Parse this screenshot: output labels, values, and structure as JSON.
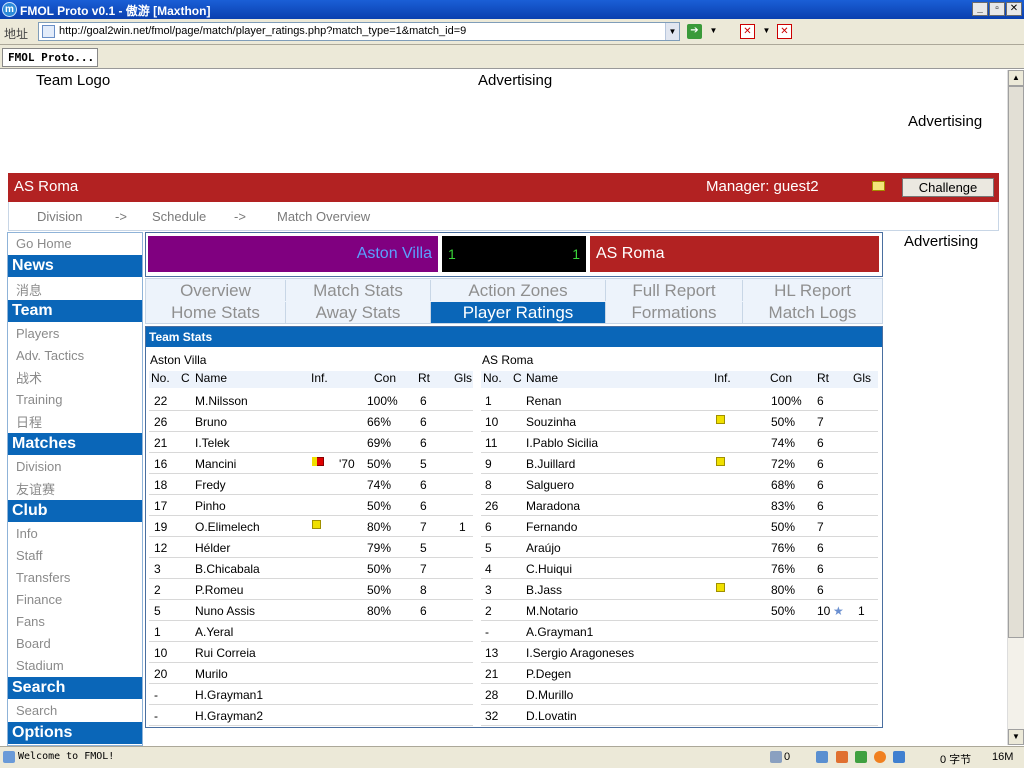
{
  "window": {
    "title": "FMOL Proto v0.1 - 傲游 [Maxthon]"
  },
  "addressbar": {
    "label": "地址",
    "url": "http://goal2win.net/fmol/page/match/player_ratings.php?match_type=1&match_id=9"
  },
  "browser_tab": {
    "label": "FMOL Proto..."
  },
  "statusbar": {
    "text": "Welcome to FMOL!",
    "trash_count": "0",
    "bytes": "0 字节",
    "memory": "16M"
  },
  "header": {
    "team_logo": "Team Logo",
    "ad_top": "Advertising",
    "ad_right": "Advertising"
  },
  "teambar": {
    "team": "AS Roma",
    "manager": "Manager: guest2",
    "challenge": "Challenge"
  },
  "breadcrumb": {
    "division": "Division",
    "sep1": "->",
    "schedule": "Schedule",
    "sep2": "->",
    "overview": "Match Overview"
  },
  "sidebar": {
    "go_home": "Go Home",
    "news": "News",
    "news_cn": "消息",
    "team": "Team",
    "players": "Players",
    "adv_tactics": "Adv. Tactics",
    "tactics_cn": "战术",
    "training": "Training",
    "schedule_cn": "日程",
    "matches": "Matches",
    "division": "Division",
    "friendly_cn": "友谊赛",
    "club": "Club",
    "info": "Info",
    "staff": "Staff",
    "transfers": "Transfers",
    "finance": "Finance",
    "fans": "Fans",
    "board": "Board",
    "stadium": "Stadium",
    "search": "Search",
    "search_link": "Search",
    "options": "Options"
  },
  "ad_side": "Advertising",
  "score": {
    "home": "Aston Villa",
    "home_goals": "1",
    "away_goals": "1",
    "away": "AS Roma"
  },
  "tabs": {
    "overview": "Overview",
    "match_stats": "Match Stats",
    "action_zones": "Action Zones",
    "full_report": "Full Report",
    "hl_report": "HL Report",
    "home_stats": "Home Stats",
    "away_stats": "Away Stats",
    "player_ratings": "Player Ratings",
    "formations": "Formations",
    "match_logs": "Match Logs"
  },
  "stats": {
    "title": "Team Stats",
    "headers": {
      "no": "No.",
      "c": "C",
      "name": "Name",
      "inf": "Inf.",
      "con": "Con",
      "rt": "Rt",
      "gls": "Gls"
    },
    "home": {
      "team": "Aston Villa",
      "rows": [
        {
          "no": "22",
          "name": "M.Nilsson",
          "min": "",
          "con": "100%",
          "rt": "6",
          "gls": ""
        },
        {
          "no": "26",
          "name": "Bruno",
          "min": "",
          "con": "66%",
          "rt": "6",
          "gls": ""
        },
        {
          "no": "21",
          "name": "I.Telek",
          "min": "",
          "con": "69%",
          "rt": "6",
          "gls": ""
        },
        {
          "no": "16",
          "name": "Mancini",
          "min": "'70",
          "con": "50%",
          "rt": "5",
          "gls": ""
        },
        {
          "no": "18",
          "name": "Fredy",
          "min": "",
          "con": "74%",
          "rt": "6",
          "gls": ""
        },
        {
          "no": "17",
          "name": "Pinho",
          "min": "",
          "con": "50%",
          "rt": "6",
          "gls": ""
        },
        {
          "no": "19",
          "name": "O.Elimelech",
          "min": "",
          "con": "80%",
          "rt": "7",
          "gls": "1"
        },
        {
          "no": "12",
          "name": "Hélder",
          "min": "",
          "con": "79%",
          "rt": "5",
          "gls": ""
        },
        {
          "no": "3",
          "name": "B.Chicabala",
          "min": "",
          "con": "50%",
          "rt": "7",
          "gls": ""
        },
        {
          "no": "2",
          "name": "P.Romeu",
          "min": "",
          "con": "50%",
          "rt": "8",
          "gls": ""
        },
        {
          "no": "5",
          "name": "Nuno Assis",
          "min": "",
          "con": "80%",
          "rt": "6",
          "gls": ""
        },
        {
          "no": "1",
          "name": "A.Yeral",
          "min": "",
          "con": "",
          "rt": "",
          "gls": ""
        },
        {
          "no": "10",
          "name": "Rui Correia",
          "min": "",
          "con": "",
          "rt": "",
          "gls": ""
        },
        {
          "no": "20",
          "name": "Murilo",
          "min": "",
          "con": "",
          "rt": "",
          "gls": ""
        },
        {
          "no": "-",
          "name": "H.Grayman1",
          "min": "",
          "con": "",
          "rt": "",
          "gls": ""
        },
        {
          "no": "-",
          "name": "H.Grayman2",
          "min": "",
          "con": "",
          "rt": "",
          "gls": ""
        }
      ]
    },
    "away": {
      "team": "AS Roma",
      "rows": [
        {
          "no": "1",
          "name": "Renan",
          "con": "100%",
          "rt": "6",
          "gls": ""
        },
        {
          "no": "10",
          "name": "Souzinha",
          "con": "50%",
          "rt": "7",
          "gls": ""
        },
        {
          "no": "11",
          "name": "I.Pablo Sicilia",
          "con": "74%",
          "rt": "6",
          "gls": ""
        },
        {
          "no": "9",
          "name": "B.Juillard",
          "con": "72%",
          "rt": "6",
          "gls": ""
        },
        {
          "no": "8",
          "name": "Salguero",
          "con": "68%",
          "rt": "6",
          "gls": ""
        },
        {
          "no": "26",
          "name": "Maradona",
          "con": "83%",
          "rt": "6",
          "gls": ""
        },
        {
          "no": "6",
          "name": "Fernando",
          "con": "50%",
          "rt": "7",
          "gls": ""
        },
        {
          "no": "5",
          "name": "Araújo",
          "con": "76%",
          "rt": "6",
          "gls": ""
        },
        {
          "no": "4",
          "name": "C.Huiqui",
          "con": "76%",
          "rt": "6",
          "gls": ""
        },
        {
          "no": "3",
          "name": "B.Jass",
          "con": "80%",
          "rt": "6",
          "gls": ""
        },
        {
          "no": "2",
          "name": "M.Notario",
          "con": "50%",
          "rt": "10",
          "gls": "1"
        },
        {
          "no": "-",
          "name": "A.Grayman1",
          "con": "",
          "rt": "",
          "gls": ""
        },
        {
          "no": "13",
          "name": "I.Sergio Aragoneses",
          "con": "",
          "rt": "",
          "gls": ""
        },
        {
          "no": "21",
          "name": "P.Degen",
          "con": "",
          "rt": "",
          "gls": ""
        },
        {
          "no": "28",
          "name": "D.Murillo",
          "con": "",
          "rt": "",
          "gls": ""
        },
        {
          "no": "32",
          "name": "D.Lovatin",
          "con": "",
          "rt": "",
          "gls": ""
        }
      ]
    }
  }
}
